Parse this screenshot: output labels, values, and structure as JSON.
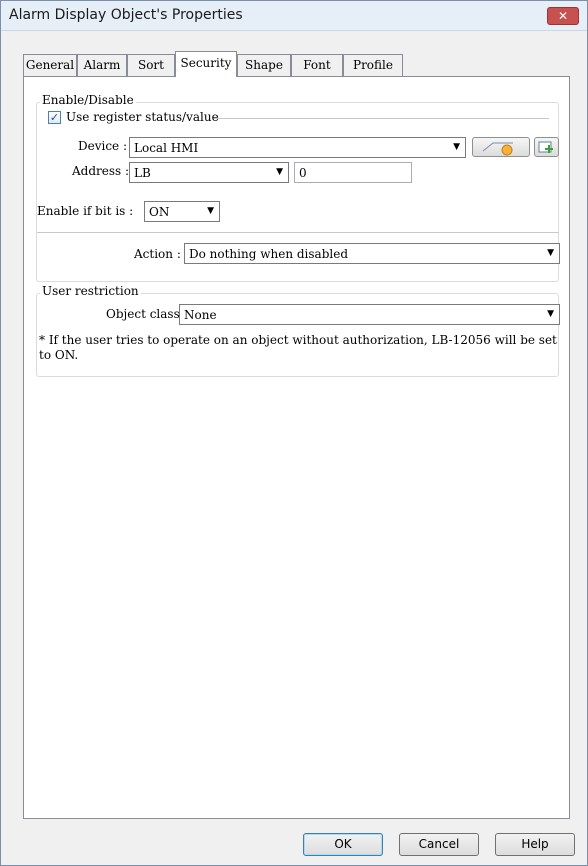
{
  "window": {
    "title": "Alarm Display Object's Properties",
    "close_label": "✕"
  },
  "tabs": [
    {
      "label": "General"
    },
    {
      "label": "Alarm"
    },
    {
      "label": "Sort"
    },
    {
      "label": "Security"
    },
    {
      "label": "Shape"
    },
    {
      "label": "Font"
    },
    {
      "label": "Profile"
    }
  ],
  "active_tab": "Security",
  "enable_disable": {
    "legend": "Enable/Disable",
    "use_register_label": "Use register status/value",
    "use_register_checked": "✓",
    "device_label": "Device :",
    "device_value": "Local HMI",
    "address_label": "Address :",
    "address_type": "LB",
    "address_value": "0",
    "enable_bit_label": "Enable if bit is :",
    "enable_bit_value": "ON",
    "action_label": "Action :",
    "action_value": "Do nothing when disabled"
  },
  "user_restriction": {
    "legend": "User restriction",
    "object_class_label": "Object class :",
    "object_class_value": "None",
    "note": "* If the user tries to operate on an object without authorization, LB-12056 will be set to ON."
  },
  "buttons": {
    "ok": "OK",
    "cancel": "Cancel",
    "help": "Help"
  },
  "icons": {
    "dropdown": "▼",
    "settings_icon": "gear-icon",
    "add_icon": "plus-icon"
  }
}
